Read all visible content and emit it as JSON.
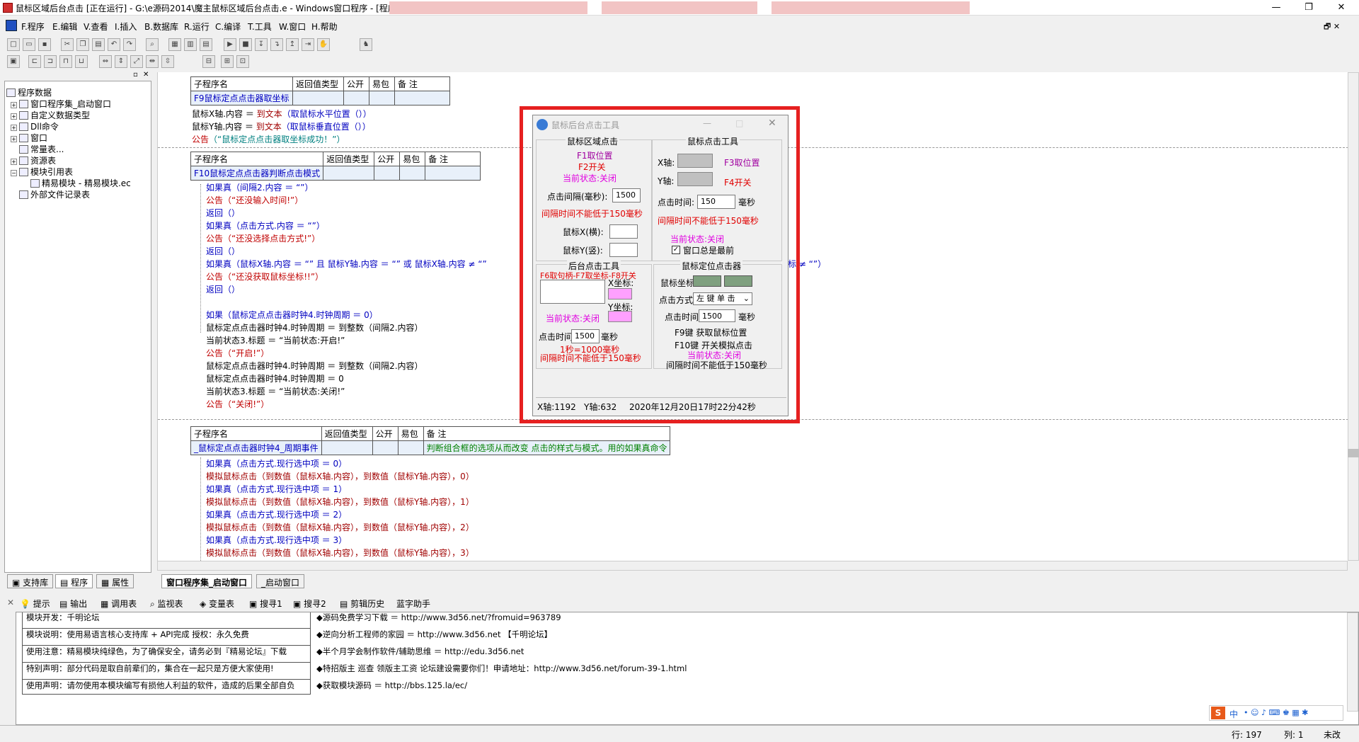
{
  "window": {
    "title": "鼠标区域后台点击 [正在运行] - G:\\e源码2014\\魔主鼠标区域后台点击.e - Windows窗口程序 - [程序集: 窗口程序集_启动窗口 / _启动窗口]",
    "minimize": "—",
    "restore": "❐",
    "close": "✕"
  },
  "menu": {
    "items": [
      "F.程序",
      "E.编辑",
      "V.查看",
      "I.插入",
      "B.数据库",
      "R.运行",
      "C.编译",
      "T.工具",
      "W.窗口",
      "H.帮助"
    ]
  },
  "tree": {
    "items": [
      "程序数据",
      "窗口程序集_启动窗口",
      "自定义数据类型",
      "Dll命令",
      "窗口",
      "常量表...",
      "资源表",
      "模块引用表",
      "精易模块 - 精易模块.ec",
      "外部文件记录表"
    ]
  },
  "left_tabs": [
    "支持库",
    "程序",
    "属性"
  ],
  "editor_tabs": [
    "窗口程序集_启动窗口",
    "_启动窗口"
  ],
  "headers": {
    "name": "子程序名",
    "ret": "返回值类型",
    "pub": "公开",
    "easy": "易包",
    "note": "备 注"
  },
  "sub1": {
    "name": "F9鼠标定点点击器取坐标",
    "lines": [
      [
        "鼠标X轴.内容 ＝ ",
        "到文本",
        "（取鼠标水平位置（））"
      ],
      [
        "鼠标Y轴.内容 ＝ ",
        "到文本",
        "（取鼠标垂直位置（））"
      ],
      [
        "公告",
        "（“鼠标定点点击器取坐标成功！”）",
        ""
      ]
    ]
  },
  "sub2": {
    "name": "F10鼠标定点点击器判断点击模式",
    "lines": [
      "如果真（间隔2.内容 ＝ “”）",
      "公告（“还没输入时间!”）",
      "返回（）",
      "如果真（点击方式.内容 ＝ “”）",
      "公告（“还没选择点击方式!”）",
      "返回（）",
      "如果真（鼠标X轴.内容 ＝ “” 且 鼠标Y轴.内容 ＝ “” 或 鼠标X轴.内容 ≠ “”",
      "标 ≠ “”）",
      "公告（“还没获取鼠标坐标!!”）",
      "返回（）",
      "如果（鼠标定点点击器时钟4.时钟周期 ＝ 0）",
      "鼠标定点点击器时钟4.时钟周期 ＝ 到整数（间隔2.内容）",
      "当前状态3.标题 ＝ “当前状态:开启!”",
      "公告（“开启!”）",
      "鼠标定点点击器时钟4.时钟周期 ＝ 到整数（间隔2.内容）",
      "鼠标定点点击器时钟4.时钟周期 ＝ 0",
      "当前状态3.标题 ＝ “当前状态:关闭!”",
      "公告（“关闭!”）"
    ]
  },
  "sub3": {
    "name": "_鼠标定点点击器时钟4_周期事件",
    "note": "判断组合框的选项从而改变 点击的样式与模式。用的如果真命令",
    "lines": [
      "如果真（点击方式.现行选中项 ＝ 0）",
      "模拟鼠标点击（到数值（鼠标X轴.内容），到数值（鼠标Y轴.内容），0）",
      "如果真（点击方式.现行选中项 ＝ 1）",
      "模拟鼠标点击（到数值（鼠标X轴.内容），到数值（鼠标Y轴.内容），1）",
      "如果真（点击方式.现行选中项 ＝ 2）",
      "模拟鼠标点击（到数值（鼠标X轴.内容），到数值（鼠标Y轴.内容），2）",
      "如果真（点击方式.现行选中项 ＝ 3）",
      "模拟鼠标点击（到数值（鼠标X轴.内容），到数值（鼠标Y轴.内容），3）"
    ]
  },
  "dialog": {
    "title": "鼠标后台点击工具",
    "g1": {
      "title": "鼠标区域点击",
      "f1": "F1取位置",
      "f2": "F2开关",
      "state": "当前状态:关闭",
      "interval_label": "点击间隔(毫秒):",
      "interval_value": "1500",
      "warn": "间隔时间不能低于150毫秒",
      "x_label": "鼠标X(横):",
      "y_label": "鼠标Y(竖):"
    },
    "g2": {
      "title": "鼠标点击工具",
      "x_label": "X轴:",
      "y_label": "Y轴:",
      "f3": "F3取位置",
      "f4": "F4开关",
      "time_label": "点击时间:",
      "time_value": "150",
      "ms": "毫秒",
      "warn": "间隔时间不能低于150毫秒",
      "state": "当前状态:关闭",
      "topmost": "窗口总是最前"
    },
    "g3": {
      "title": "后台点击工具",
      "hint": "F6取句柄-F7取坐标-F8开关",
      "xc": "X坐标:",
      "yc": "Y坐标:",
      "state": "当前状态:关闭",
      "time_label": "点击时间:",
      "time_value": "1500",
      "ms": "毫秒",
      "sec": "1秒=1000毫秒",
      "warn": "间隔时间不能低于150毫秒"
    },
    "g4": {
      "title": "鼠标定位点击器",
      "coord_label": "鼠标坐标",
      "mode_label": "点击方式",
      "mode_value": "左 键 单 击",
      "time_label": "点击时间:",
      "time_value": "1500",
      "ms": "毫秒",
      "f9": "F9键   获取鼠标位置",
      "f10": "F10键  开关模拟点击",
      "state": "当前状态:关闭",
      "warn": "间隔时间不能低于150毫秒"
    },
    "status": {
      "x": "X轴:1192",
      "y": "Y轴:632",
      "time": "2020年12月20日17时22分42秒"
    }
  },
  "output_tabs": [
    "提示",
    "输出",
    "调用表",
    "监视表",
    "变量表",
    "搜寻1",
    "搜寻2",
    "剪辑历史",
    "蓝字助手"
  ],
  "output_left": [
    "模块开发：千明论坛",
    "模块说明：使用易语言核心支持库 + API完成      授权：永久免费",
    "使用注意：精易模块纯绿色，为了确保安全，请务必到『精易论坛』下载",
    "特别声明：部分代码是取自前辈们的，集合在一起只是方便大家使用!",
    "使用声明：请勿使用本模块编写有损他人利益的软件，造成的后果全部自负"
  ],
  "output_right": [
    "◆源码免费学习下载  ＝ http://www.3d56.net/?fromuid=963789",
    "◆逆向分析工程师的家园   ＝ http://www.3d56.net 【千明论坛】",
    "◆半个月学会制作软件/辅助思维  ＝ http://edu.3d56.net",
    "◆特招版主 巡查 领版主工资 论坛建设需要你们！申请地址：http://www.3d56.net/forum-39-1.html",
    "◆获取模块源码    ＝ http://bbs.125.la/ec/"
  ],
  "statusbar": {
    "row": "行: 197",
    "col": "列: 1",
    "mode": "未改"
  },
  "ime": {
    "logo": "S",
    "lang": "中"
  }
}
